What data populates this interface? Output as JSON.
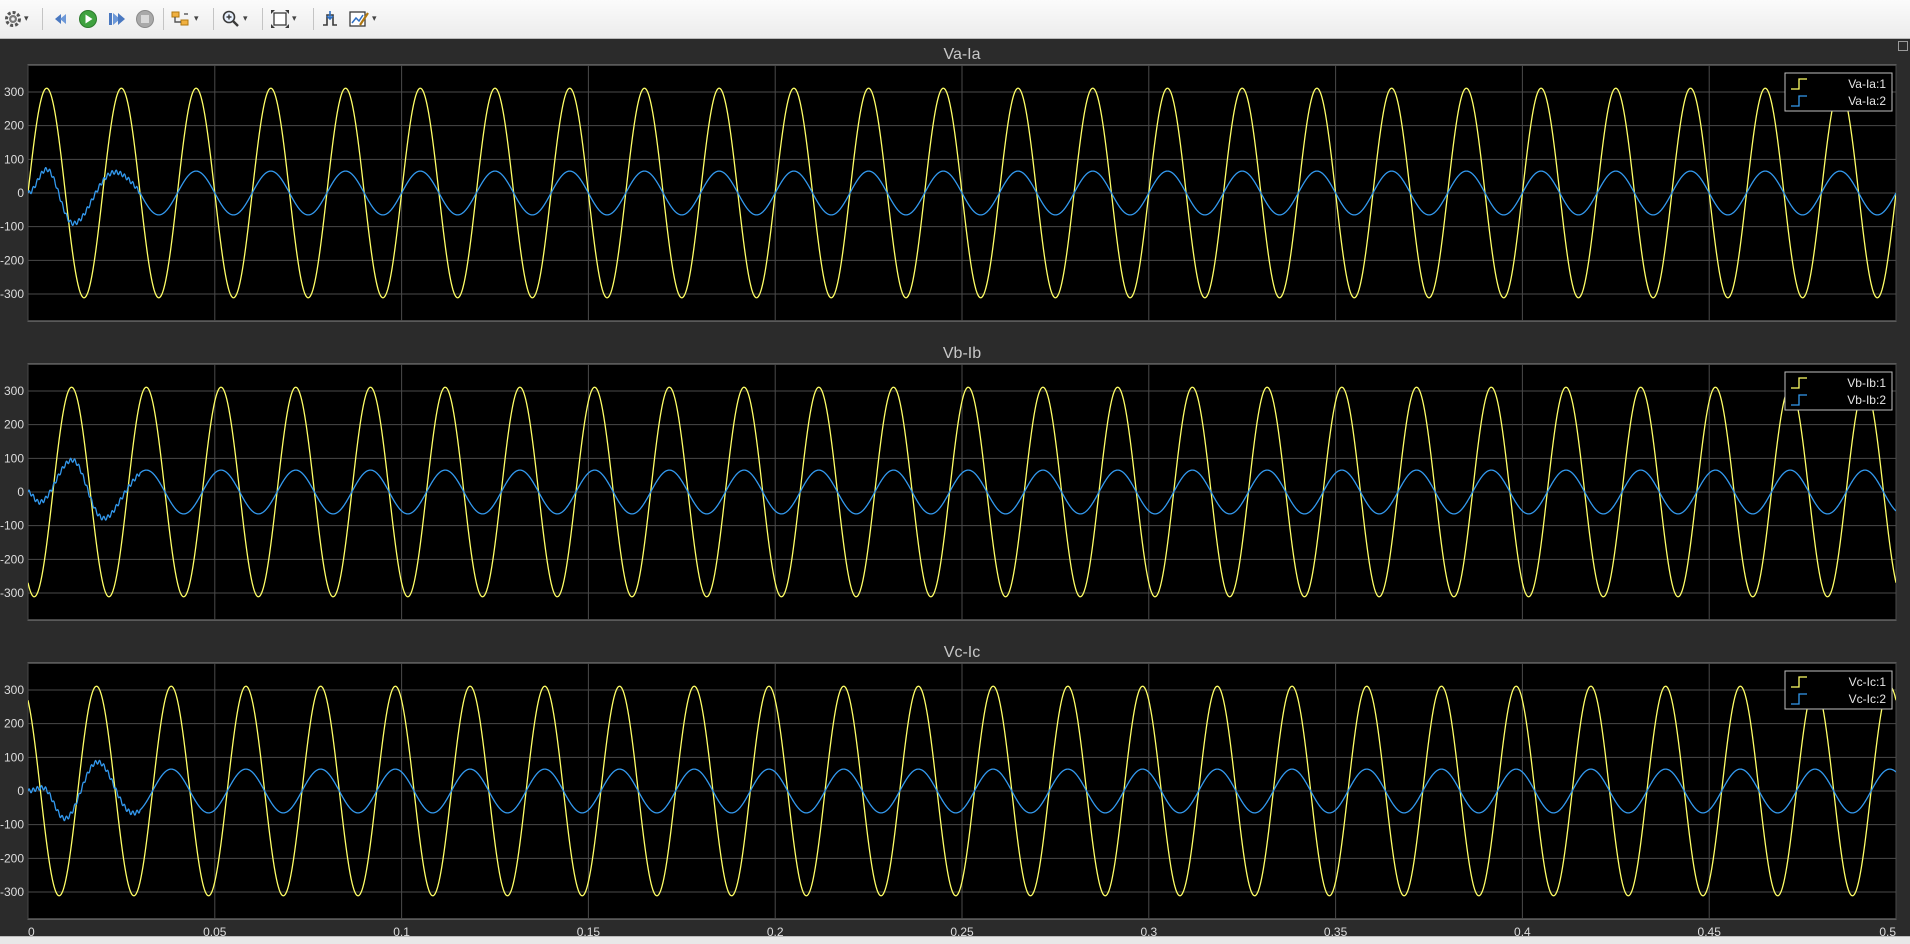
{
  "toolbar": {
    "icons": [
      "gear-icon",
      "step-back-icon",
      "run-icon",
      "step-forward-icon",
      "stop-icon",
      "highlight-icon",
      "zoom-icon",
      "fit-axes-icon",
      "triggers-icon",
      "measurements-icon"
    ]
  },
  "colors": {
    "background": "#2b2b2b",
    "plot_background": "#000000",
    "grid": "#4a4a4a",
    "series1": "#ffff66",
    "series2": "#3399ee"
  },
  "chart_data": [
    {
      "type": "line",
      "title": "Va-Ia",
      "xlim": [
        0,
        0.5
      ],
      "ylim": [
        -380,
        380
      ],
      "xticks": [
        0,
        0.05,
        0.1,
        0.15,
        0.2,
        0.25,
        0.3,
        0.35,
        0.4,
        0.45,
        0.5
      ],
      "xtick_labels": [
        "0",
        "0.05",
        "0.1",
        "0.15",
        "0.2",
        "0.25",
        "0.3",
        "0.35",
        "0.4",
        "0.45",
        "0.5"
      ],
      "yticks": [
        -300,
        -200,
        -100,
        0,
        100,
        200,
        300
      ],
      "ytick_labels": [
        "-300",
        "-200",
        "-100",
        "0",
        "100",
        "200",
        "300"
      ],
      "grid": true,
      "legend_position": "top-right",
      "frequency_hz": 50,
      "series": [
        {
          "name": "Va-Ia:1",
          "amplitude": 311,
          "phase_deg": 0
        },
        {
          "name": "Va-Ia:2",
          "amplitude": 65,
          "phase_deg": 0,
          "transient_end_s": 0.03,
          "transient_peaks": [
            [
              0.005,
              70
            ],
            [
              0.012,
              -100
            ],
            [
              0.022,
              80
            ],
            [
              0.03,
              -60
            ]
          ]
        }
      ]
    },
    {
      "type": "line",
      "title": "Vb-Ib",
      "xlim": [
        0,
        0.5
      ],
      "ylim": [
        -380,
        380
      ],
      "xticks": [
        0,
        0.05,
        0.1,
        0.15,
        0.2,
        0.25,
        0.3,
        0.35,
        0.4,
        0.45,
        0.5
      ],
      "xtick_labels": [
        "0",
        "0.05",
        "0.1",
        "0.15",
        "0.2",
        "0.25",
        "0.3",
        "0.35",
        "0.4",
        "0.45",
        "0.5"
      ],
      "yticks": [
        -300,
        -200,
        -100,
        0,
        100,
        200,
        300
      ],
      "ytick_labels": [
        "-300",
        "-200",
        "-100",
        "0",
        "100",
        "200",
        "300"
      ],
      "grid": true,
      "legend_position": "top-right",
      "frequency_hz": 50,
      "series": [
        {
          "name": "Vb-Ib:1",
          "amplitude": 311,
          "phase_deg": -120
        },
        {
          "name": "Vb-Ib:2",
          "amplitude": 65,
          "phase_deg": -120,
          "transient_end_s": 0.03,
          "transient_peaks": [
            [
              0.003,
              -30
            ],
            [
              0.012,
              100
            ],
            [
              0.02,
              -95
            ],
            [
              0.028,
              60
            ]
          ]
        }
      ]
    },
    {
      "type": "line",
      "title": "Vc-Ic",
      "xlim": [
        0,
        0.5
      ],
      "ylim": [
        -380,
        380
      ],
      "xticks": [
        0,
        0.05,
        0.1,
        0.15,
        0.2,
        0.25,
        0.3,
        0.35,
        0.4,
        0.45,
        0.5
      ],
      "xtick_labels": [
        "0",
        "0.05",
        "0.1",
        "0.15",
        "0.2",
        "0.25",
        "0.3",
        "0.35",
        "0.4",
        "0.45",
        "0.5"
      ],
      "yticks": [
        -300,
        -200,
        -100,
        0,
        100,
        200,
        300
      ],
      "ytick_labels": [
        "-300",
        "-200",
        "-100",
        "0",
        "100",
        "200",
        "300"
      ],
      "grid": true,
      "legend_position": "top-right",
      "frequency_hz": 50,
      "series": [
        {
          "name": "Vc-Ic:1",
          "amplitude": 311,
          "phase_deg": 120
        },
        {
          "name": "Vc-Ic:2",
          "amplitude": 65,
          "phase_deg": 120,
          "transient_end_s": 0.03,
          "transient_peaks": [
            [
              0.004,
              10
            ],
            [
              0.01,
              -85
            ],
            [
              0.019,
              100
            ],
            [
              0.028,
              -70
            ]
          ]
        }
      ]
    }
  ]
}
